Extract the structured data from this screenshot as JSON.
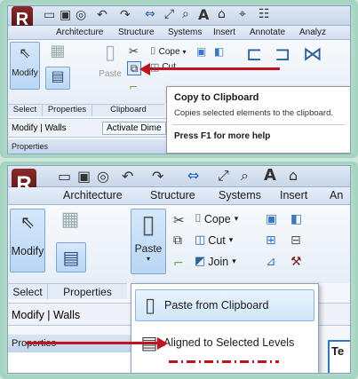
{
  "app": {
    "logo_letter": "R",
    "brand_color": "#7a1f1f",
    "accent_red": "#c1121f"
  },
  "top": {
    "tabs": [
      "Architecture",
      "Structure",
      "Systems",
      "Insert",
      "Annotate",
      "Analyz"
    ],
    "buttons": {
      "modify": "Modify",
      "properties_icon": "properties-icon",
      "paste": "Paste",
      "cope": "Cope",
      "cut": "Cut"
    },
    "groups": {
      "select": "Select",
      "properties": "Properties",
      "clipboard": "Clipboard"
    },
    "context": {
      "title": "Modify | Walls",
      "activate": "Activate Dime"
    },
    "properties_partial": "Properties",
    "tooltip": {
      "title": "Copy to Clipboard",
      "desc": "Copies selected elements to the clipboard.",
      "help": "Press F1 for more help"
    }
  },
  "bottom": {
    "tabs": [
      "Architecture",
      "Structure",
      "Systems",
      "Insert",
      "An"
    ],
    "buttons": {
      "modify": "Modify",
      "paste": "Paste",
      "cope": "Cope",
      "cut": "Cut",
      "join": "Join"
    },
    "groups": {
      "select": "Select",
      "properties": "Properties"
    },
    "context": {
      "title": "Modify | Walls"
    },
    "properties_header": "Properties",
    "right_tab": "Te",
    "menu": {
      "items": [
        "Paste from Clipboard",
        "Aligned to Selected Levels"
      ]
    }
  }
}
